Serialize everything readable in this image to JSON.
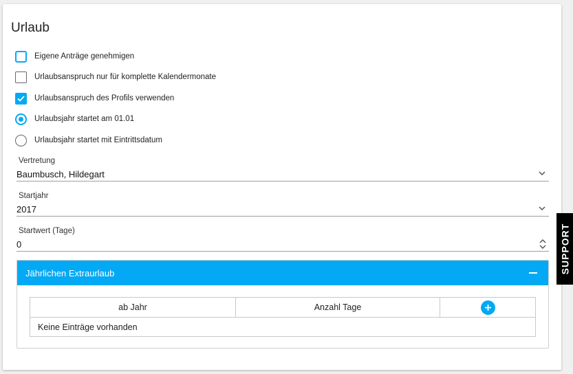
{
  "title": "Urlaub",
  "options": {
    "approve_own": "Eigene Anträge genehmigen",
    "full_months": "Urlaubsanspruch nur für komplette Kalendermonate",
    "use_profile": "Urlaubsanspruch des Profils verwenden",
    "year_start_0101": "Urlaubsjahr startet am 01.01",
    "year_start_entry": "Urlaubsjahr startet mit Eintrittsdatum"
  },
  "fields": {
    "vertretung_label": "Vertretung",
    "vertretung_value": "Baumbusch, Hildegart",
    "startjahr_label": "Startjahr",
    "startjahr_value": "2017",
    "startwert_label": "Startwert (Tage)",
    "startwert_value": "0"
  },
  "extra_panel": {
    "title": "Jährlichen Extraurlaub",
    "columns": [
      "ab Jahr",
      "Anzahl Tage"
    ],
    "empty_text": "Keine Einträge vorhanden"
  },
  "support_tab": "SUPPORT",
  "colors": {
    "accent": "#03a9f4"
  },
  "icons": {
    "check": "check-icon",
    "chevron": "chevron-down-icon",
    "stepper": "stepper-icon",
    "collapse": "minus-icon",
    "add": "plus-icon"
  }
}
